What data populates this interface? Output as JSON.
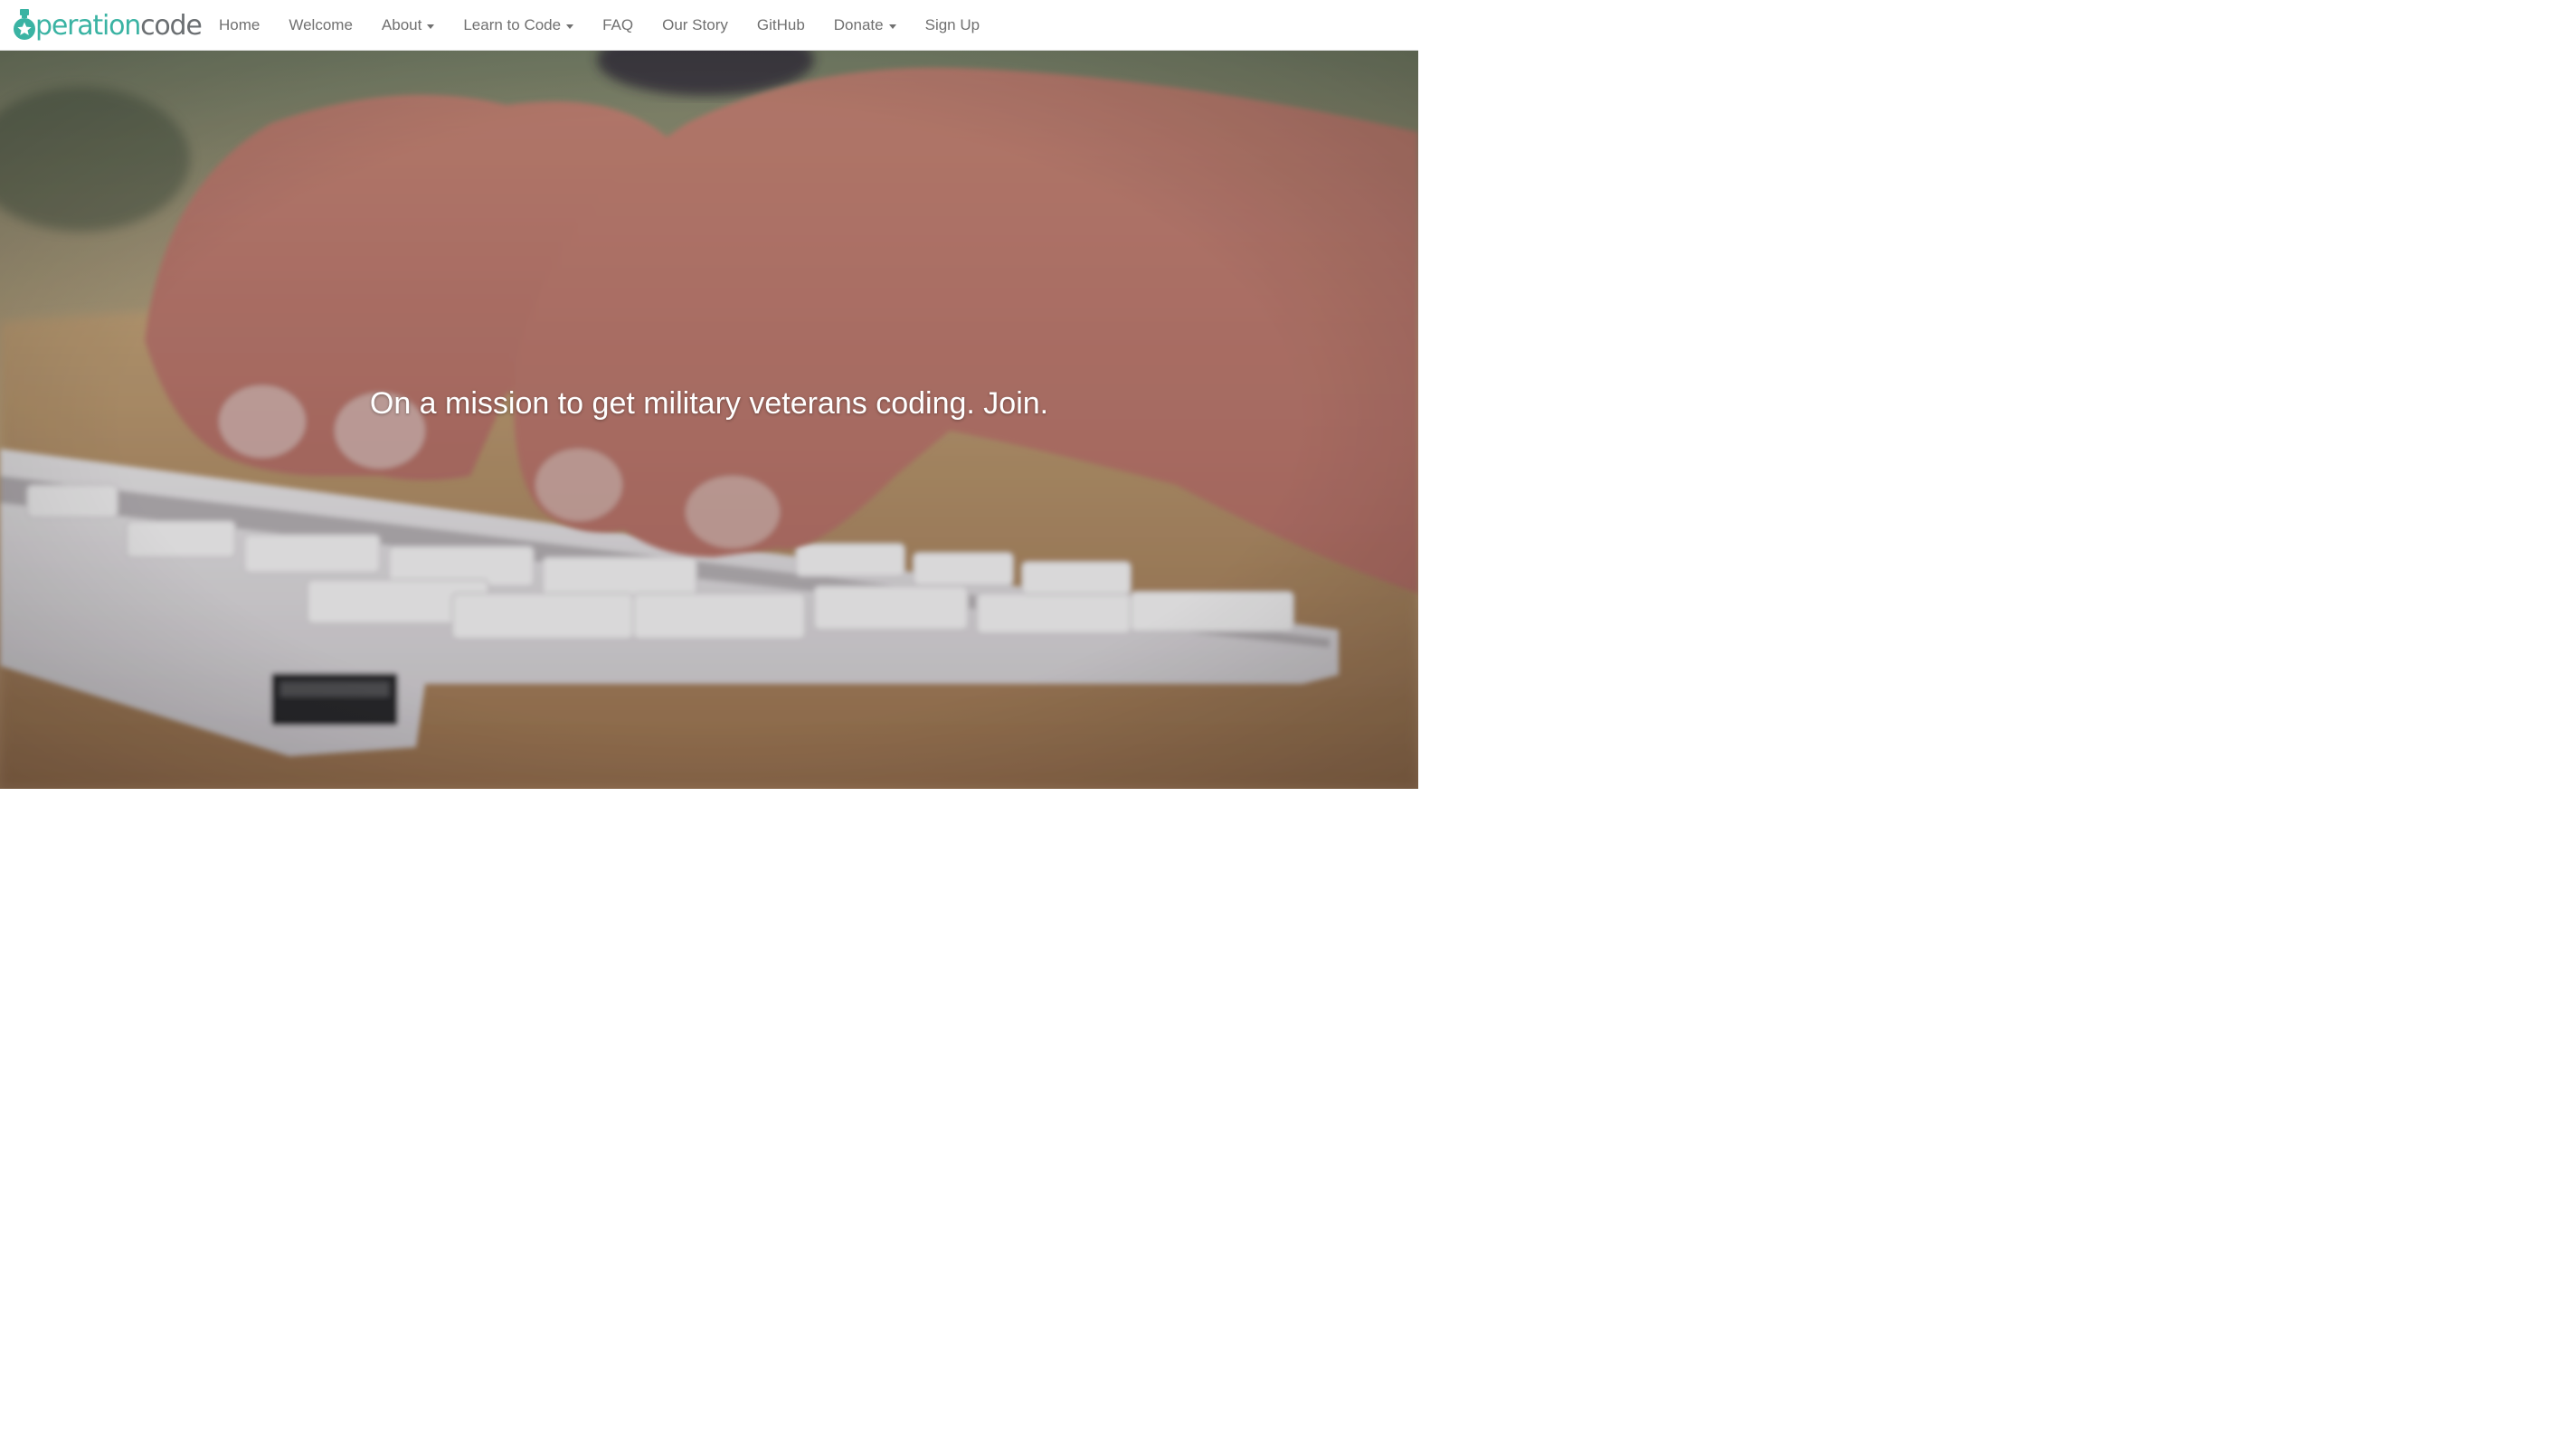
{
  "brand": {
    "logo_part1": "peration",
    "logo_part2": "code",
    "colors": {
      "accent": "#3ab3a3",
      "text_gray": "#6b6f72"
    }
  },
  "nav": {
    "items": [
      {
        "label": "Home",
        "dropdown": false
      },
      {
        "label": "Welcome",
        "dropdown": false
      },
      {
        "label": "About",
        "dropdown": true
      },
      {
        "label": "Learn to Code",
        "dropdown": true
      },
      {
        "label": "FAQ",
        "dropdown": false
      },
      {
        "label": "Our Story",
        "dropdown": false
      },
      {
        "label": "GitHub",
        "dropdown": false
      },
      {
        "label": "Donate",
        "dropdown": true
      },
      {
        "label": "Sign Up",
        "dropdown": false
      }
    ]
  },
  "hero": {
    "tagline": "On a mission to get military veterans coding. Join."
  }
}
